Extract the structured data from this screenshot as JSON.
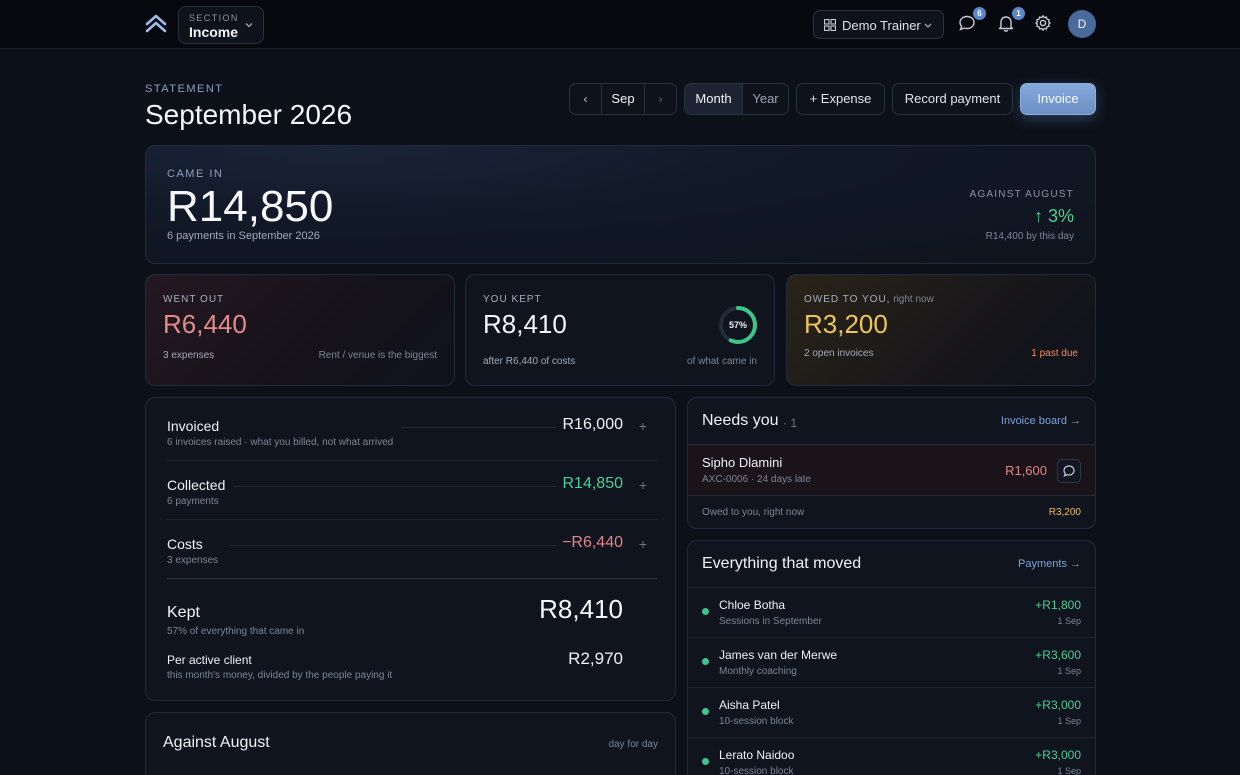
{
  "topbar": {
    "section_kicker": "SECTION",
    "section_value": "Income",
    "trainer_label": "Demo Trainer",
    "messages_badge": "6",
    "notifications_badge": "1",
    "avatar_initial": "D"
  },
  "header": {
    "kicker": "STATEMENT",
    "title": "September 2026",
    "month_prev": "‹",
    "month_current": "Sep",
    "month_next": "›",
    "period_options": [
      "Month",
      "Year"
    ],
    "period_selected": "Month",
    "expense_button": "+ Expense",
    "record_payment_button": "Record payment",
    "invoice_button": "Invoice"
  },
  "hero": {
    "kicker": "CAME IN",
    "amount": "R14,850",
    "sub": "6 payments in September 2026",
    "compare_kicker": "AGAINST AUGUST",
    "compare_value": "↑ 3%",
    "compare_sub": "R14,400 by this day"
  },
  "stats": {
    "went_out": {
      "kicker": "WENT OUT",
      "amount": "R6,440",
      "foot_left": "3 expenses",
      "foot_right": "Rent / venue is the biggest"
    },
    "kept": {
      "kicker": "YOU KEPT",
      "amount": "R8,410",
      "foot_left": "after R6,440 of costs",
      "foot_right": "of what came in",
      "ring_label": "57%",
      "ring_fraction": 0.57
    },
    "owed": {
      "kicker": "OWED TO YOU,",
      "kicker_suffix": " right now",
      "amount": "R3,200",
      "foot_left": "2 open invoices",
      "foot_right": "1 past due"
    }
  },
  "breakdown": {
    "rows": [
      {
        "title": "Invoiced",
        "sub": "6 invoices raised · what you billed, not what arrived",
        "value": "R16,000",
        "plus": "+"
      },
      {
        "title": "Collected",
        "sub": "6 payments",
        "value": "R14,850",
        "plus": "+"
      },
      {
        "title": "Costs",
        "sub": "3 expenses",
        "value": "−R6,440",
        "plus": "+"
      }
    ],
    "kept_title": "Kept",
    "kept_sub": "57% of everything that came in",
    "kept_value": "R8,410",
    "per_client_title": "Per active client",
    "per_client_sub": "this month's money, divided by the people paying it",
    "per_client_value": "R2,970"
  },
  "against_august": {
    "title": "Against August",
    "right": "day for day"
  },
  "needs_you": {
    "title": "Needs you",
    "count": "· 1",
    "link": "Invoice board →",
    "item": {
      "name": "Sipho Dlamini",
      "meta": "AXC-0006 · 24 days late",
      "amount": "R1,600"
    },
    "owed_label": "Owed to you, right now",
    "owed_value": "R3,200"
  },
  "moved": {
    "title": "Everything that moved",
    "link": "Payments →",
    "items": [
      {
        "name": "Chloe Botha",
        "desc": "Sessions in September",
        "amount": "+R1,800",
        "date": "1 Sep"
      },
      {
        "name": "James van der Merwe",
        "desc": "Monthly coaching",
        "amount": "+R3,600",
        "date": "1 Sep"
      },
      {
        "name": "Aisha Patel",
        "desc": "10-session block",
        "amount": "+R3,000",
        "date": "1 Sep"
      },
      {
        "name": "Lerato Naidoo",
        "desc": "10-session block",
        "amount": "+R3,000",
        "date": "1 Sep"
      }
    ]
  },
  "colors": {
    "accent": "#6b8fc6",
    "positive": "#4fcf93",
    "negative": "#e38585",
    "warning": "#e9c15e",
    "background": "#0c1019"
  }
}
